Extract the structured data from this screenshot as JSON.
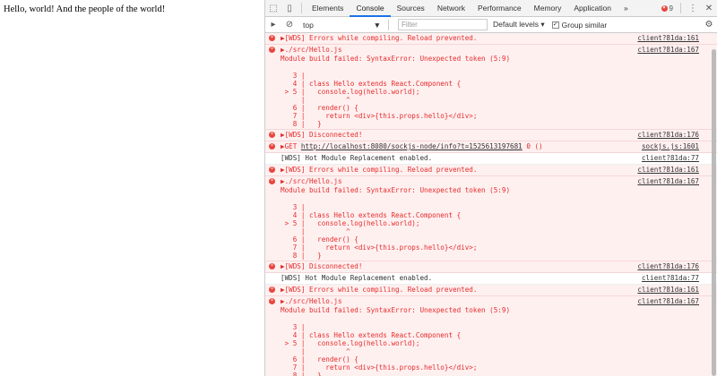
{
  "page": {
    "text": "Hello, world! And the people of the world!"
  },
  "devtools": {
    "tabs": [
      "Elements",
      "Console",
      "Sources",
      "Network",
      "Performance",
      "Memory",
      "Application"
    ],
    "active_tab": "Console",
    "more": "»",
    "error_count": "9",
    "context": "top",
    "filter_placeholder": "Filter",
    "levels": "Default levels ▾",
    "group_similar": "Group similar",
    "group_checked": true
  },
  "code_block": "\n   3 |\n   4 | class Hello extends React.Component {\n > 5 |   console.log(hello.world);\n     |          ^\n   6 |   render() {\n   7 |     return <div>{this.props.hello}</div>;\n   8 |   }",
  "messages": [
    {
      "type": "err",
      "text": "▶[WDS] Errors while compiling. Reload prevented.",
      "src": "client?81da:161"
    },
    {
      "type": "err",
      "text": "▶./src/Hello.js\nModule build failed: SyntaxError: Unexpected token (5:9)",
      "src": "client?81da:167",
      "code": true
    },
    {
      "type": "err",
      "text": "▶[WDS] Disconnected!",
      "src": "client?81da:176"
    },
    {
      "type": "err",
      "text": "▶GET ",
      "url": "http://localhost:8080/sockjs-node/info?t=1525613197681",
      "tail": " 0 ()",
      "src": "sockjs.js:1601"
    },
    {
      "type": "info",
      "text": "[WDS] Hot Module Replacement enabled.",
      "src": "client?81da:77"
    },
    {
      "type": "err",
      "text": "▶[WDS] Errors while compiling. Reload prevented.",
      "src": "client?81da:161"
    },
    {
      "type": "err",
      "text": "▶./src/Hello.js\nModule build failed: SyntaxError: Unexpected token (5:9)",
      "src": "client?81da:167",
      "code": true
    },
    {
      "type": "err",
      "text": "▶[WDS] Disconnected!",
      "src": "client?81da:176"
    },
    {
      "type": "info",
      "text": "[WDS] Hot Module Replacement enabled.",
      "src": "client?81da:77"
    },
    {
      "type": "err",
      "text": "▶[WDS] Errors while compiling. Reload prevented.",
      "src": "client?81da:161"
    },
    {
      "type": "err",
      "text": "▶./src/Hello.js\nModule build failed: SyntaxError: Unexpected token (5:9)",
      "src": "client?81da:167",
      "code": true
    }
  ]
}
